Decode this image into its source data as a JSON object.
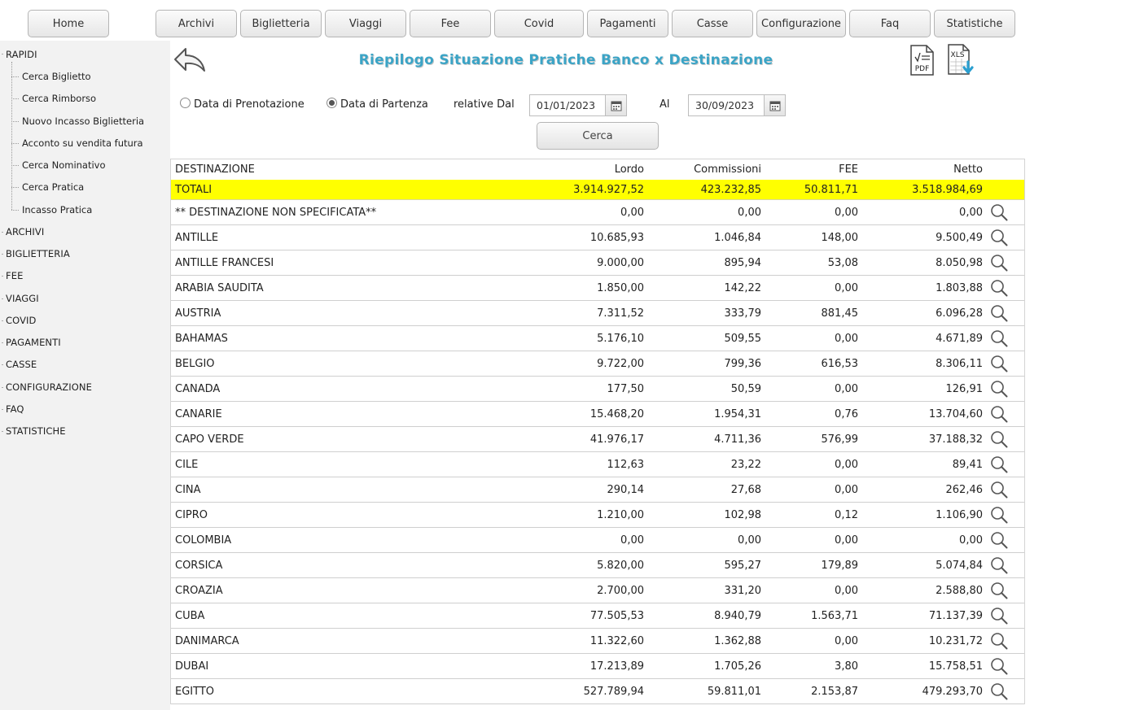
{
  "nav": {
    "home": "Home",
    "items": [
      "Archivi",
      "Biglietteria",
      "Viaggi",
      "Fee",
      "Covid",
      "Pagamenti",
      "Casse",
      "Configurazione",
      "Faq",
      "Statistiche"
    ]
  },
  "sidebar": {
    "rapidi": "RAPIDI",
    "quick_links": [
      "Cerca Biglietto",
      "Cerca Rimborso",
      "Nuovo Incasso Biglietteria",
      "Acconto su vendita futura",
      "Cerca Nominativo",
      "Cerca Pratica",
      "Incasso Pratica"
    ],
    "groups": [
      "ARCHIVI",
      "BIGLIETTERIA",
      "FEE",
      "VIAGGI",
      "COVID",
      "PAGAMENTI",
      "CASSE",
      "CONFIGURAZIONE",
      "FAQ",
      "STATISTICHE"
    ]
  },
  "page": {
    "title": "Riepilogo Situazione Pratiche Banco x Destinazione",
    "pdf_icon": "pdf-export-icon",
    "xls_icon": "xls-export-icon",
    "back_icon": "back-arrow-icon"
  },
  "filters": {
    "radio_prenotazione": "Data di Prenotazione",
    "radio_partenza": "Data di Partenza",
    "selected": "partenza",
    "relative_dal": "relative Dal",
    "dal_value": "01/01/2023",
    "al_label": "Al",
    "al_value": "30/09/2023",
    "search_button": "Cerca"
  },
  "table": {
    "headers": {
      "destinazione": "DESTINAZIONE",
      "lordo": "Lordo",
      "commissioni": "Commissioni",
      "fee": "FEE",
      "netto": "Netto"
    },
    "totals": {
      "label": "TOTALI",
      "lordo": "3.914.927,52",
      "commissioni": "423.232,85",
      "fee": "50.811,71",
      "netto": "3.518.984,69"
    },
    "rows": [
      {
        "dest": "** DESTINAZIONE NON SPECIFICATA**",
        "lordo": "0,00",
        "comm": "0,00",
        "fee": "0,00",
        "netto": "0,00"
      },
      {
        "dest": "ANTILLE",
        "lordo": "10.685,93",
        "comm": "1.046,84",
        "fee": "148,00",
        "netto": "9.500,49"
      },
      {
        "dest": "ANTILLE FRANCESI",
        "lordo": "9.000,00",
        "comm": "895,94",
        "fee": "53,08",
        "netto": "8.050,98"
      },
      {
        "dest": "ARABIA SAUDITA",
        "lordo": "1.850,00",
        "comm": "142,22",
        "fee": "0,00",
        "netto": "1.803,88"
      },
      {
        "dest": "AUSTRIA",
        "lordo": "7.311,52",
        "comm": "333,79",
        "fee": "881,45",
        "netto": "6.096,28"
      },
      {
        "dest": "BAHAMAS",
        "lordo": "5.176,10",
        "comm": "509,55",
        "fee": "0,00",
        "netto": "4.671,89"
      },
      {
        "dest": "BELGIO",
        "lordo": "9.722,00",
        "comm": "799,36",
        "fee": "616,53",
        "netto": "8.306,11"
      },
      {
        "dest": "CANADA",
        "lordo": "177,50",
        "comm": "50,59",
        "fee": "0,00",
        "netto": "126,91"
      },
      {
        "dest": "CANARIE",
        "lordo": "15.468,20",
        "comm": "1.954,31",
        "fee": "0,76",
        "netto": "13.704,60"
      },
      {
        "dest": "CAPO VERDE",
        "lordo": "41.976,17",
        "comm": "4.711,36",
        "fee": "576,99",
        "netto": "37.188,32"
      },
      {
        "dest": "CILE",
        "lordo": "112,63",
        "comm": "23,22",
        "fee": "0,00",
        "netto": "89,41"
      },
      {
        "dest": "CINA",
        "lordo": "290,14",
        "comm": "27,68",
        "fee": "0,00",
        "netto": "262,46"
      },
      {
        "dest": "CIPRO",
        "lordo": "1.210,00",
        "comm": "102,98",
        "fee": "0,12",
        "netto": "1.106,90"
      },
      {
        "dest": "COLOMBIA",
        "lordo": "0,00",
        "comm": "0,00",
        "fee": "0,00",
        "netto": "0,00"
      },
      {
        "dest": "CORSICA",
        "lordo": "5.820,00",
        "comm": "595,27",
        "fee": "179,89",
        "netto": "5.074,84"
      },
      {
        "dest": "CROAZIA",
        "lordo": "2.700,00",
        "comm": "331,20",
        "fee": "0,00",
        "netto": "2.588,80"
      },
      {
        "dest": "CUBA",
        "lordo": "77.505,53",
        "comm": "8.940,79",
        "fee": "1.563,71",
        "netto": "71.137,39"
      },
      {
        "dest": "DANIMARCA",
        "lordo": "11.322,60",
        "comm": "1.362,88",
        "fee": "0,00",
        "netto": "10.231,72"
      },
      {
        "dest": "DUBAI",
        "lordo": "17.213,89",
        "comm": "1.705,26",
        "fee": "3,80",
        "netto": "15.758,51"
      },
      {
        "dest": "EGITTO",
        "lordo": "527.789,94",
        "comm": "59.811,01",
        "fee": "2.153,87",
        "netto": "479.293,70"
      }
    ],
    "row_icon": "magnifier-icon",
    "highlight_color": "#ffff00"
  },
  "colors": {
    "title": "#3ba4c6",
    "sidebar_bg": "#f2f2f2"
  }
}
